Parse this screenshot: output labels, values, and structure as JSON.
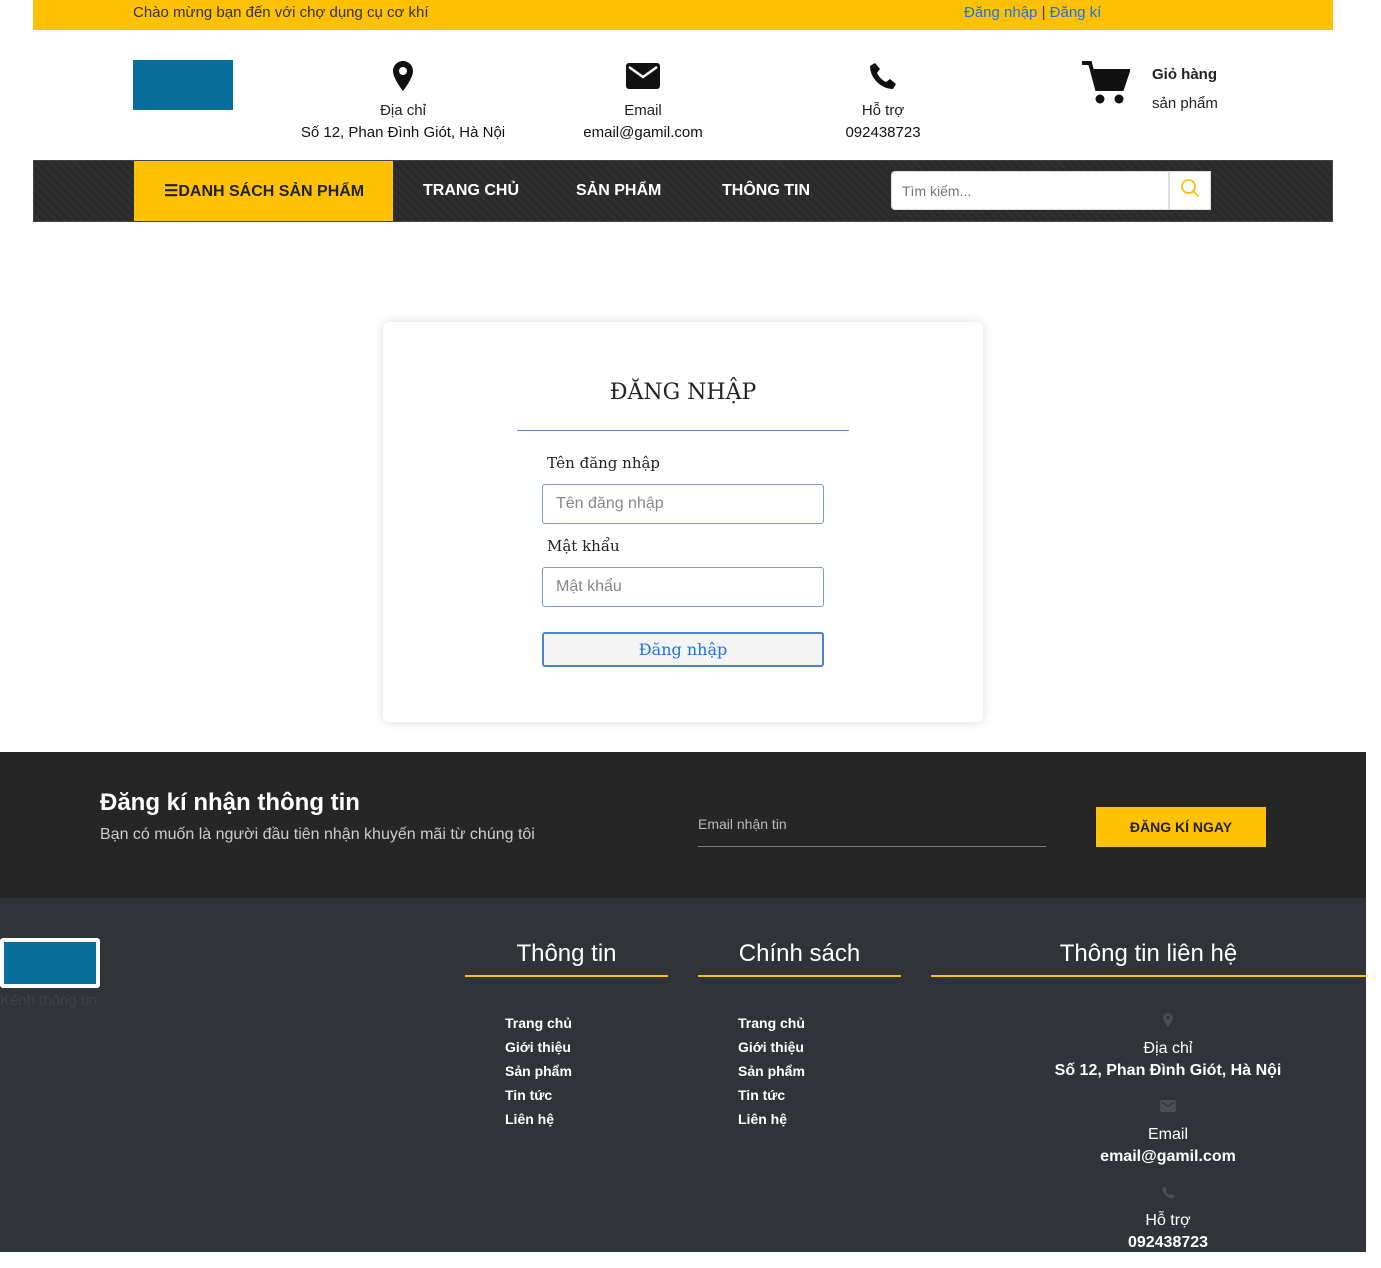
{
  "topbar": {
    "welcome": "Chào mừng bạn đến với chợ dụng cụ cơ khí",
    "login": "Đăng nhập",
    "separator": "|",
    "register": "Đăng kí"
  },
  "header": {
    "address_label": "Địa chỉ",
    "address_value": "Số 12, Phan Đình Giót, Hà Nội",
    "email_label": "Email",
    "email_value": "email@gamil.com",
    "support_label": "Hỗ trợ",
    "support_value": "092438723",
    "cart_title": "Giỏ hàng",
    "cart_sub": "sản phẩm"
  },
  "nav": {
    "categories": "☰DANH SÁCH SẢN PHẨM",
    "items": [
      "TRANG CHỦ",
      "SẢN PHẨM",
      "THÔNG TIN"
    ],
    "search_placeholder": "Tìm kiếm..."
  },
  "login": {
    "title": "ĐĂNG NHẬP",
    "username_label": "Tên đăng nhập",
    "username_placeholder": "Tên đăng nhập",
    "password_label": "Mật khẩu",
    "password_placeholder": "Mật khẩu",
    "submit": "Đăng nhập"
  },
  "newsletter": {
    "title": "Đăng kí nhận thông tin",
    "subtitle": "Bạn có muốn là người đầu tiên nhận khuyến mãi từ chúng tôi",
    "email_placeholder": "Email nhận tin",
    "button": "ĐĂNG KÍ NGAY"
  },
  "footer": {
    "channel": "Kênh thông tin",
    "col1_title": "Thông tin",
    "col1_links": [
      "Trang chủ",
      "Giới thiệu",
      "Sản phẩm",
      "Tin tức",
      "Liên hệ"
    ],
    "col2_title": "Chính sách",
    "col2_links": [
      "Trang chủ",
      "Giới thiệu",
      "Sản phẩm",
      "Tin tức",
      "Liên hệ"
    ],
    "col3_title": "Thông tin liên hệ",
    "address_label": "Địa chỉ",
    "address_value": "Số 12, Phan Đình Giót, Hà Nội",
    "email_label": "Email",
    "email_value": "email@gamil.com",
    "support_label": "Hỗ trợ",
    "support_value": "092438723"
  },
  "colors": {
    "accent": "#fec104",
    "logo": "#086e9c",
    "nav_bg": "#2a2a2a",
    "newsletter_bg": "#262626",
    "footer_bg": "#303438",
    "link": "#1a73e8"
  }
}
